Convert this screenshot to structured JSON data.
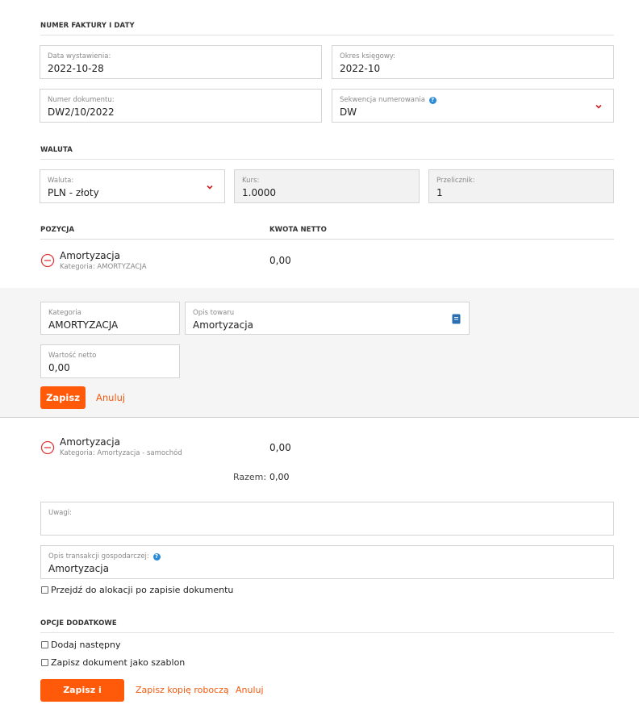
{
  "section_invoice": {
    "title": "NUMER FAKTURY I DATY"
  },
  "issue_date": {
    "label": "Data wystawienia:",
    "value": "2022-10-28"
  },
  "accounting_period": {
    "label": "Okres księgowy:",
    "value": "2022-10"
  },
  "document_number": {
    "label": "Numer dokumentu:",
    "value": "DW2/10/2022"
  },
  "numbering_sequence": {
    "label": "Sekwencja numerowania",
    "value": "DW"
  },
  "section_currency": {
    "title": "WALUTA"
  },
  "currency": {
    "label": "Waluta:",
    "value": "PLN - złoty"
  },
  "rate": {
    "label": "Kurs:",
    "value": "1.0000"
  },
  "converter": {
    "label": "Przelicznik:",
    "value": "1"
  },
  "positions": {
    "col_position": "POZYCJA",
    "col_net": "KWOTA NETTO",
    "items": [
      {
        "name": "Amortyzacja",
        "category": "Kategoria: AMORTYZACJA",
        "amount": "0,00"
      },
      {
        "name": "Amortyzacja",
        "category": "Kategoria: Amortyzacja - samochód",
        "amount": "0,00"
      }
    ]
  },
  "edit": {
    "category": {
      "label": "Kategoria",
      "value": "AMORTYZACJA"
    },
    "description": {
      "label": "Opis towaru",
      "value": "Amortyzacja"
    },
    "net_value": {
      "label": "Wartość netto",
      "value": "0,00"
    },
    "save_label": "Zapisz",
    "cancel_label": "Anuluj"
  },
  "total": {
    "label": "Razem:",
    "value": "0,00"
  },
  "notes": {
    "label": "Uwagi:",
    "value": ""
  },
  "transaction_desc": {
    "label": "Opis transakcji gospodarczej:",
    "value": "Amortyzacja"
  },
  "goto_allocation": {
    "label": "Przejdź do alokacji po zapisie dokumentu",
    "checked": false
  },
  "section_options": {
    "title": "OPCJE DODATKOWE"
  },
  "add_next": {
    "label": "Dodaj następny",
    "checked": false
  },
  "save_as_template": {
    "label": "Zapisz dokument jako szablon",
    "checked": false
  },
  "footer": {
    "save_post_label": "Zapisz i zaksięguj",
    "save_draft_label": "Zapisz kopię roboczą",
    "cancel_label": "Anuluj"
  },
  "colors": {
    "accent": "#ff5a0a",
    "remove": "#e03a3a",
    "help": "#2a8bd8"
  }
}
